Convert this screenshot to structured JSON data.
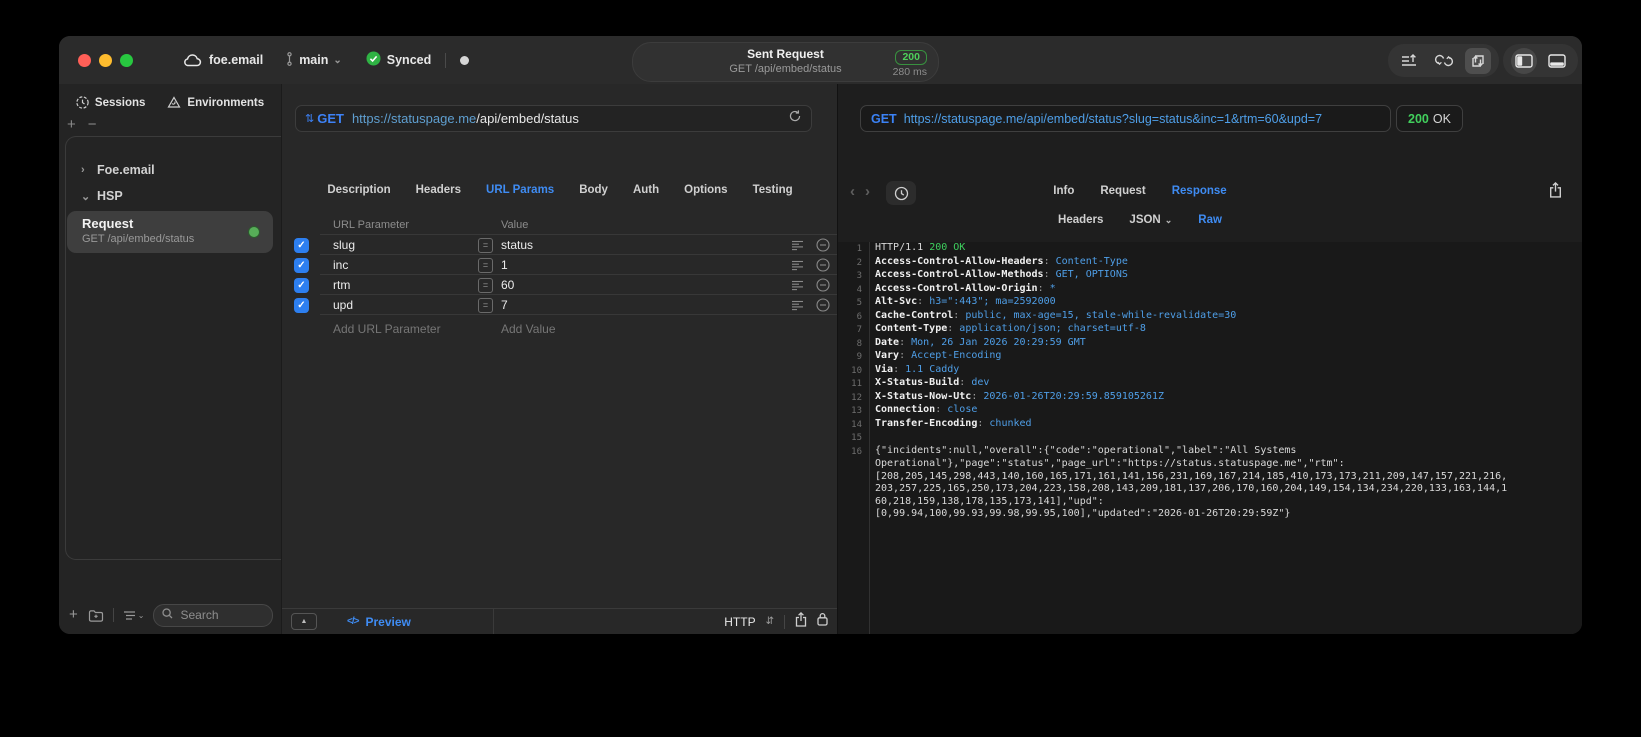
{
  "colors": {
    "accent_blue": "#3d82f7",
    "link_blue": "#4f9fe8",
    "success_green": "#3ecf5e",
    "status_dot_green": "#57ad58"
  },
  "titlebar": {
    "project": "foe.email",
    "branch": "main",
    "sync_label": "Synced",
    "request_title": "Sent Request",
    "request_subtitle": "GET /api/embed/status",
    "status_code": "200",
    "duration": "280 ms"
  },
  "sidebar": {
    "tabs": [
      {
        "label": "Sessions"
      },
      {
        "label": "Environments"
      }
    ],
    "tree": [
      {
        "label": "Foe.email"
      },
      {
        "label": "HSP"
      }
    ],
    "request_item": {
      "title": "Request",
      "subtitle": "GET /api/embed/status"
    },
    "search_placeholder": "Search"
  },
  "request_pane": {
    "method": "GET",
    "url_host": "https://statuspage.me",
    "url_path": "/api/embed/status",
    "tabs": [
      "Description",
      "Headers",
      "URL Params",
      "Body",
      "Auth",
      "Options",
      "Testing"
    ],
    "active_tab": "URL Params",
    "table": {
      "col_param": "URL Parameter",
      "col_value": "Value",
      "rows": [
        {
          "name": "slug",
          "value": "status",
          "checked": true
        },
        {
          "name": "inc",
          "value": "1",
          "checked": true
        },
        {
          "name": "rtm",
          "value": "60",
          "checked": true
        },
        {
          "name": "upd",
          "value": "7",
          "checked": true
        }
      ],
      "add_param_label": "Add URL Parameter",
      "add_value_label": "Add Value"
    },
    "footer": {
      "preview_label": "Preview",
      "protocol_label": "HTTP"
    }
  },
  "response_pane": {
    "method": "GET",
    "url": "https://statuspage.me/api/embed/status?slug=status&inc=1&rtm=60&upd=7",
    "status_badge": {
      "code": "200",
      "text": "OK"
    },
    "tabs": [
      "Info",
      "Request",
      "Response"
    ],
    "active_tab": "Response",
    "subtabs": [
      {
        "label": "Headers"
      },
      {
        "label": "JSON",
        "dropdown": true
      },
      {
        "label": "Raw"
      }
    ],
    "active_subtab": "Raw",
    "code": {
      "status_line": {
        "protocol": "HTTP/1.1 ",
        "status": "200 OK"
      },
      "headers": [
        {
          "name": "Access-Control-Allow-Headers",
          "value": "Content-Type"
        },
        {
          "name": "Access-Control-Allow-Methods",
          "value": "GET, OPTIONS"
        },
        {
          "name": "Access-Control-Allow-Origin",
          "value": "*"
        },
        {
          "name": "Alt-Svc",
          "value": "h3=\":443\"; ma=2592000"
        },
        {
          "name": "Cache-Control",
          "value": "public, max-age=15, stale-while-revalidate=30"
        },
        {
          "name": "Content-Type",
          "value": "application/json; charset=utf-8"
        },
        {
          "name": "Date",
          "value": "Mon, 26 Jan 2026 20:29:59 GMT"
        },
        {
          "name": "Vary",
          "value": "Accept-Encoding"
        },
        {
          "name": "Via",
          "value": "1.1 Caddy"
        },
        {
          "name": "X-Status-Build",
          "value": "dev"
        },
        {
          "name": "X-Status-Now-Utc",
          "value": "2026-01-26T20:29:59.859105261Z"
        },
        {
          "name": "Connection",
          "value": "close"
        },
        {
          "name": "Transfer-Encoding",
          "value": "chunked"
        }
      ],
      "body_first_line_number": 16,
      "body_lines": [
        "{\"incidents\":null,\"overall\":{\"code\":\"operational\",\"label\":\"All Systems",
        "Operational\"},\"page\":\"status\",\"page_url\":\"https://status.statuspage.me\",\"rtm\":",
        "[208,205,145,298,443,140,160,165,171,161,141,156,231,169,167,214,185,410,173,173,211,209,147,157,221,216,",
        "203,257,225,165,250,173,204,223,158,208,143,209,181,137,206,170,160,204,149,154,134,234,220,133,163,144,1",
        "60,218,159,138,178,135,173,141],\"upd\":",
        "[0,99.94,100,99.93,99.98,99.95,100],\"updated\":\"2026-01-26T20:29:59Z\"}"
      ]
    }
  }
}
